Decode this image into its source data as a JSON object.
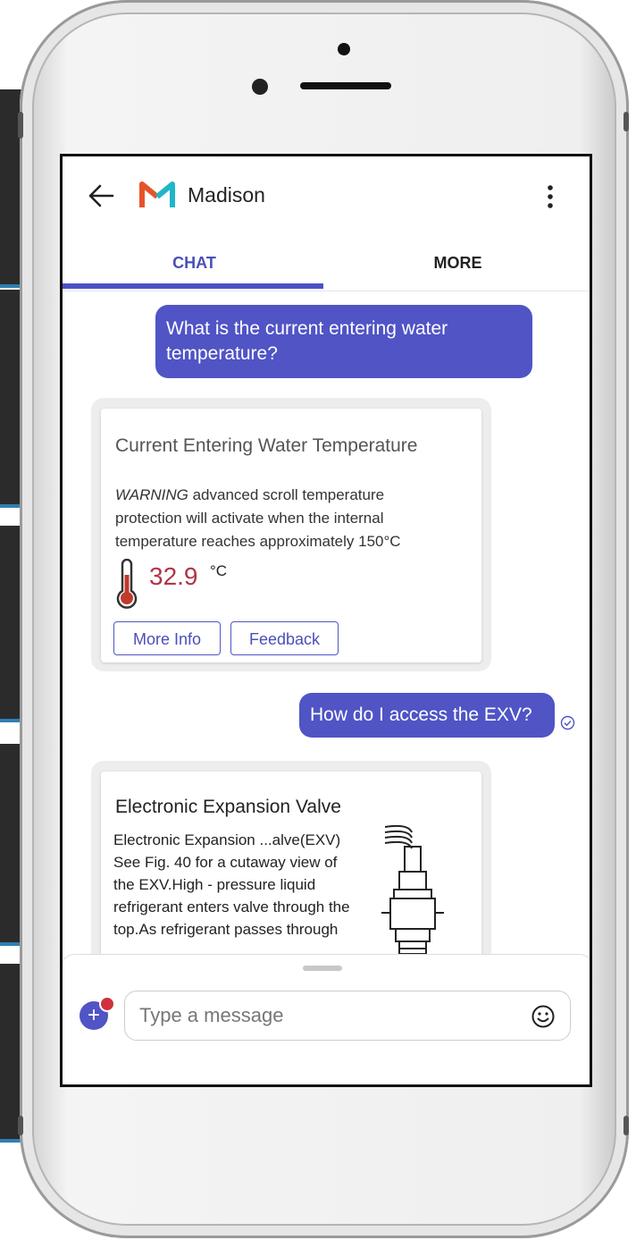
{
  "app": {
    "title": "Madison"
  },
  "tabs": [
    {
      "label": "CHAT"
    },
    {
      "label": "MORE"
    }
  ],
  "messages": [
    {
      "type": "user",
      "text": "What is the current entering water temperature?"
    },
    {
      "type": "card",
      "title": "Current Entering Water Temperature",
      "warning_label": "WARNING",
      "warning_text": " advanced scroll temperature protection will activate when the internal temperature reaches approximately 150°C",
      "value": "32.9",
      "unit": "°C",
      "buttons": [
        {
          "label": "More Info"
        },
        {
          "label": "Feedback"
        }
      ]
    },
    {
      "type": "user",
      "text": "How do I access the EXV?"
    },
    {
      "type": "card",
      "title": "Electronic Expansion Valve",
      "body": "Electronic Expansion ...alve(EXV) See Fig. 40 for a cutaway view of the EXV.High - pressure liquid refrigerant enters valve through the top.As refrigerant passes through"
    }
  ],
  "composer": {
    "placeholder": "Type a message"
  },
  "colors": {
    "accent": "#5054c5",
    "temperature": "#b0344a",
    "badge": "#d0313d"
  }
}
